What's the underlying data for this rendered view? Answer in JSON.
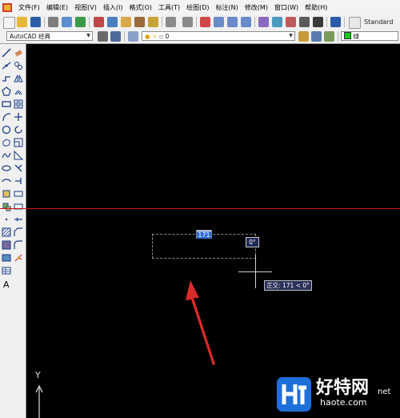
{
  "menubar": {
    "items": [
      "文件(F)",
      "编辑(E)",
      "视图(V)",
      "插入(I)",
      "格式(O)",
      "工具(T)",
      "绘图(D)",
      "标注(N)",
      "修改(M)",
      "窗口(W)",
      "帮助(H)"
    ]
  },
  "toolbar": {
    "text_style": "Standard",
    "workspace": "AutoCAD 经典",
    "layer": "0",
    "color": "绿"
  },
  "drawing": {
    "length_input": "171",
    "angle_input": "0°",
    "ortho_tooltip": "正交: 171 < 0°",
    "ucs_y_label": "Y"
  },
  "watermark": {
    "brand": "好特网",
    "url": "haote.com",
    "suffix": "net"
  },
  "colors": {
    "accent_line": "#c8161c",
    "annotation_arrow": "#d92b2b",
    "canvas": "#000000"
  }
}
